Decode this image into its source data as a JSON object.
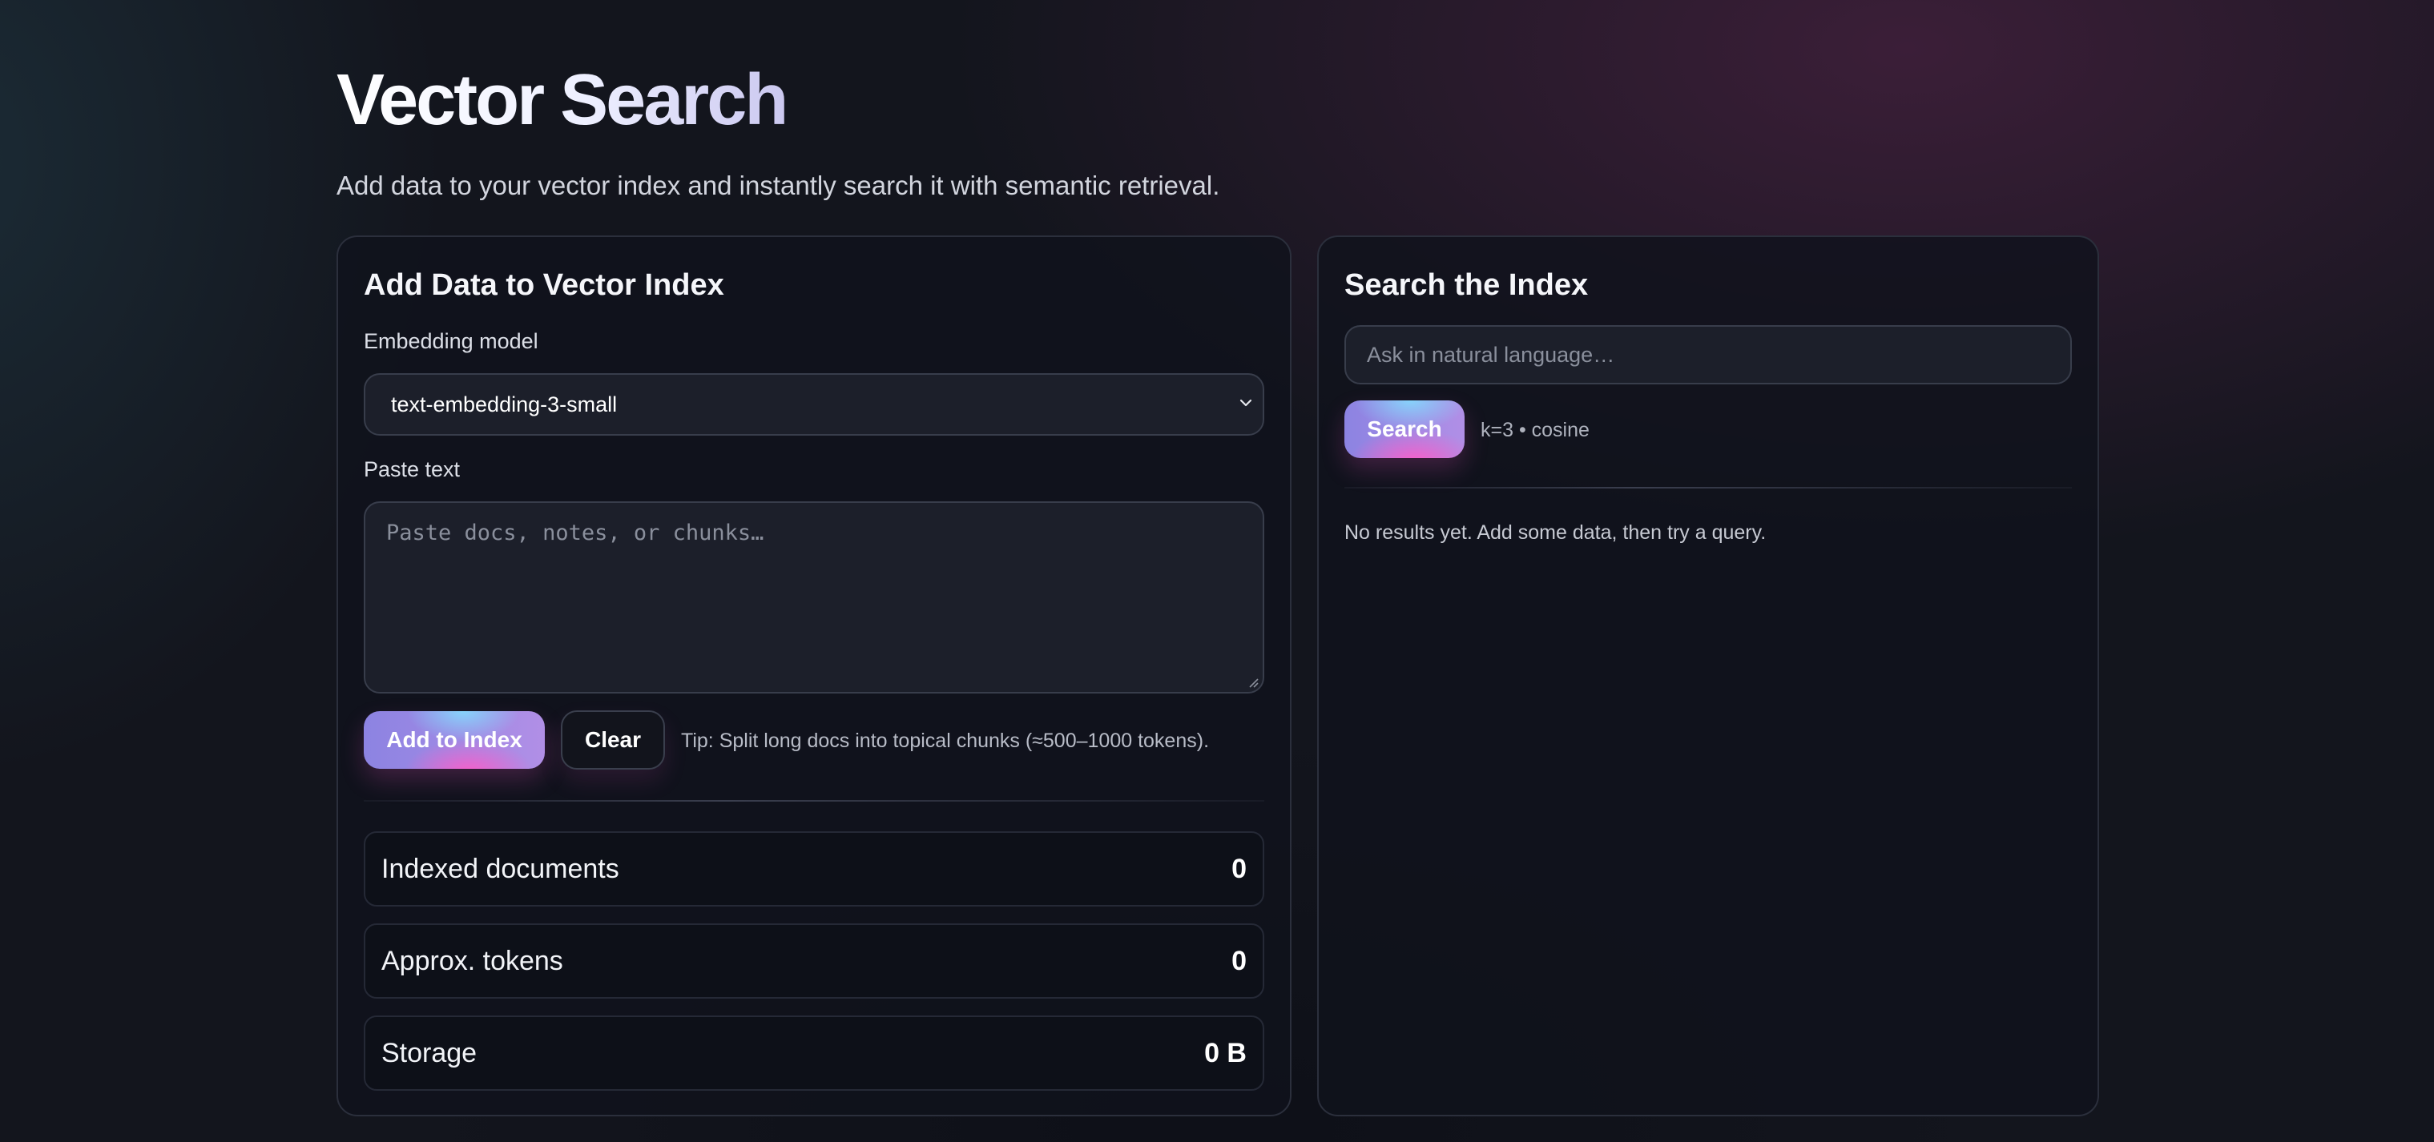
{
  "header": {
    "title": "Vector Search",
    "subtitle": "Add data to your vector index and instantly search it with semantic retrieval."
  },
  "add_panel": {
    "title": "Add Data to Vector Index",
    "model_label": "Embedding model",
    "model_value": "text-embedding-3-small",
    "text_label": "Paste text",
    "text_placeholder": "Paste docs, notes, or chunks…",
    "text_value": "",
    "add_button_label": "Add to Index",
    "clear_button_label": "Clear",
    "tip": "Tip: Split long docs into topical chunks (≈500–1000 tokens).",
    "stats": [
      {
        "label": "Indexed documents",
        "value": "0"
      },
      {
        "label": "Approx. tokens",
        "value": "0"
      },
      {
        "label": "Storage",
        "value": "0 B"
      }
    ]
  },
  "search_panel": {
    "title": "Search the Index",
    "query_placeholder": "Ask in natural language…",
    "query_value": "",
    "search_button_label": "Search",
    "meta": "k=3 • cosine",
    "empty_message": "No results yet. Add some data, then try a query."
  },
  "icons": {
    "select": "chevron-down-icon",
    "textarea": "resize-handle-icon"
  },
  "colors": {
    "background": "#13151d",
    "card": "#10121c",
    "button_gradient_start": "#8c83e2",
    "button_gradient_end": "#b18fe6",
    "button_glow_pink": "#ff5cc8",
    "button_glow_cyan": "#82e0ff"
  }
}
